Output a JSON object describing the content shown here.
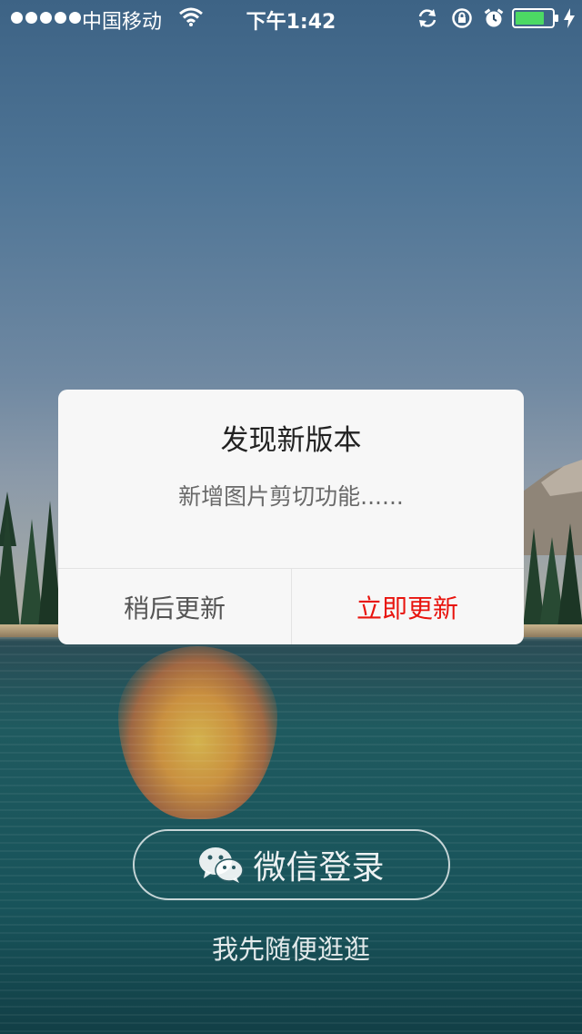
{
  "status_bar": {
    "carrier": "中国移动",
    "time": "下午1:42",
    "signal_dots": 5,
    "battery_level": 0.8,
    "icons": [
      "signal-dots-icon",
      "wifi-icon",
      "sync-icon",
      "rotation-lock-icon",
      "alarm-icon",
      "battery-icon",
      "charging-bolt-icon"
    ]
  },
  "dialog": {
    "title": "发现新版本",
    "message": "新增图片剪切功能......",
    "later_button": "稍后更新",
    "update_button": "立即更新",
    "update_button_color": "#e8140e"
  },
  "login": {
    "wechat_button": "微信登录",
    "wechat_icon": "wechat-icon",
    "browse_link": "我先随便逛逛"
  }
}
